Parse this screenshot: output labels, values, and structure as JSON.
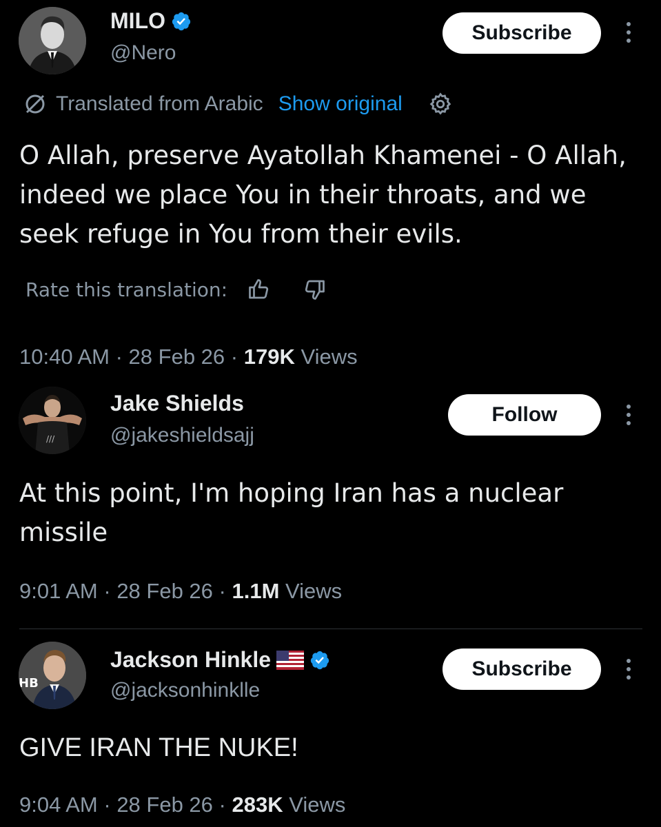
{
  "tweets": [
    {
      "name": "MILO",
      "verified": true,
      "handle": "@Nero",
      "action_label": "Subscribe",
      "translated_label": "Translated from Arabic",
      "show_original_label": "Show original",
      "text": "O Allah, preserve Ayatollah Khamenei - O Allah, indeed we place You in their throats, and we seek refuge in You from their evils.",
      "rate_label": "Rate this translation:",
      "time": "10:40 AM",
      "date": "28 Feb 26",
      "views_count": "179K",
      "views_label": "Views"
    },
    {
      "name": "Jake Shields",
      "verified": false,
      "handle": "@jakeshieldsajj",
      "action_label": "Follow",
      "text": "At this point, I'm hoping Iran has a nuclear missile",
      "time": "9:01 AM",
      "date": "28 Feb 26",
      "views_count": "1.1M",
      "views_label": "Views"
    },
    {
      "name": "Jackson Hinkle",
      "verified": true,
      "flag": "us-flag-icon",
      "handle": "@jacksonhinklle",
      "action_label": "Subscribe",
      "avatar_text": "HB",
      "text": "GIVE IRAN THE NUKE!",
      "time": "9:04 AM",
      "date": "28 Feb 26",
      "views_count": "283K",
      "views_label": "Views"
    }
  ],
  "separator": " · ",
  "colors": {
    "background": "#000000",
    "text_primary": "#e7e9ea",
    "text_secondary": "#8b98a5",
    "link_blue": "#1d9bf0",
    "verified_blue": "#1d9bf0",
    "button_bg": "#ffffff"
  }
}
